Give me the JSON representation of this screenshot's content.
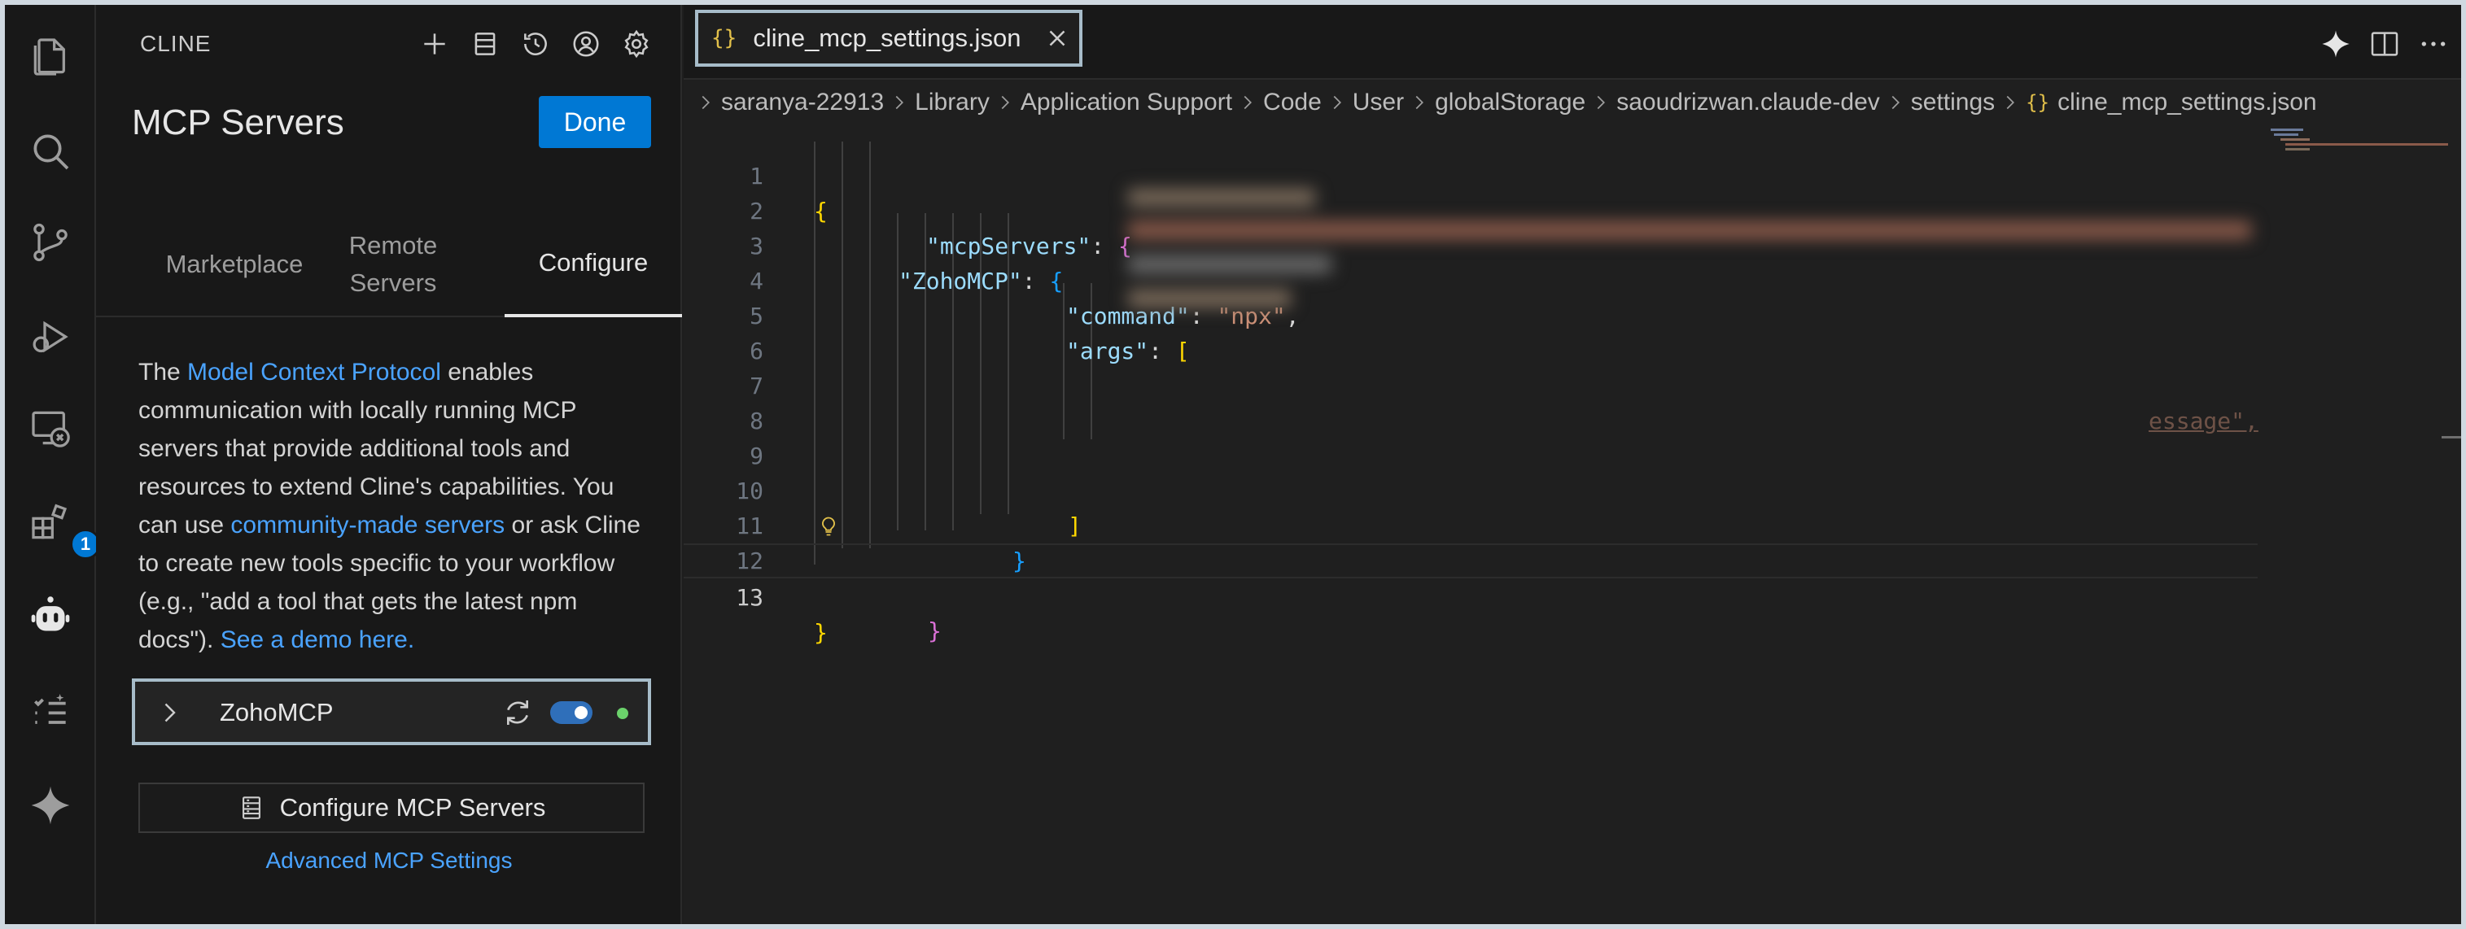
{
  "activity_bar": {
    "items": [
      {
        "icon": "files-icon"
      },
      {
        "icon": "search-icon"
      },
      {
        "icon": "source-control-icon"
      },
      {
        "icon": "run-debug-icon"
      },
      {
        "icon": "remote-explorer-icon"
      },
      {
        "icon": "extensions-icon",
        "badge": "1"
      },
      {
        "icon": "cline-robot-icon"
      },
      {
        "icon": "task-list-icon"
      },
      {
        "icon": "sparkle-icon"
      }
    ]
  },
  "side_panel": {
    "header_title": "CLINE",
    "header_icons": [
      "plus-icon",
      "history-db-icon",
      "history-icon",
      "account-icon",
      "gear-icon"
    ],
    "title": "MCP Servers",
    "done_label": "Done",
    "tabs": [
      {
        "label": "Marketplace"
      },
      {
        "label": "Remote Servers"
      },
      {
        "label": "Configure"
      }
    ],
    "active_tab": "Configure",
    "description": {
      "p1": "The ",
      "link1": "Model Context Protocol",
      "p2": " enables communication with locally running MCP servers that provide additional tools and resources to extend Cline's capabilities. You can use ",
      "link2": "community-made servers",
      "p3": " or ask Cline to create new tools specific to your workflow (e.g., \"add a tool that gets the latest npm docs\"). ",
      "link3": "See a demo here."
    },
    "server": {
      "name": "ZohoMCP",
      "enabled": true,
      "status_color": "#6bd26b"
    },
    "configure_button": "Configure MCP Servers",
    "advanced_link": "Advanced MCP Settings"
  },
  "editor": {
    "tab": {
      "label": "cline_mcp_settings.json",
      "icon": "{}"
    },
    "breadcrumb": [
      "saranya-22913",
      "Library",
      "Application Support",
      "Code",
      "User",
      "globalStorage",
      "saoudrizwan.claude-dev",
      "settings",
      "cline_mcp_settings.json"
    ],
    "lines": [
      {
        "n": "1"
      },
      {
        "n": "2"
      },
      {
        "n": "3"
      },
      {
        "n": "4"
      },
      {
        "n": "5"
      },
      {
        "n": "6"
      },
      {
        "n": "7"
      },
      {
        "n": "8"
      },
      {
        "n": "9"
      },
      {
        "n": "10"
      },
      {
        "n": "11"
      },
      {
        "n": "12"
      },
      {
        "n": "13"
      }
    ],
    "code": {
      "l1_open": "{",
      "l2_key": "\"mcpServers\"",
      "l2_colon": ": ",
      "l2_brace": "{",
      "l3_key": "\"ZohoMCP\"",
      "l3_colon": ": ",
      "l3_brace": "{",
      "l4_key": "\"command\"",
      "l4_colon": ": ",
      "l4_val": "\"npx\"",
      "l4_comma": ",",
      "l5_key": "\"args\"",
      "l5_colon": ": ",
      "l5_bracket": "[",
      "l7_partial": "essage\",",
      "l10_bracket": "]",
      "l11_brace": "}",
      "l12_brace": "}",
      "l13_close": "}"
    },
    "current_line": "13",
    "colors": {
      "key": "#9cdcfe",
      "string": "#ce9178",
      "bracket1": "#ffd700",
      "bracket2": "#da70d6",
      "bracket3": "#179fff"
    }
  }
}
